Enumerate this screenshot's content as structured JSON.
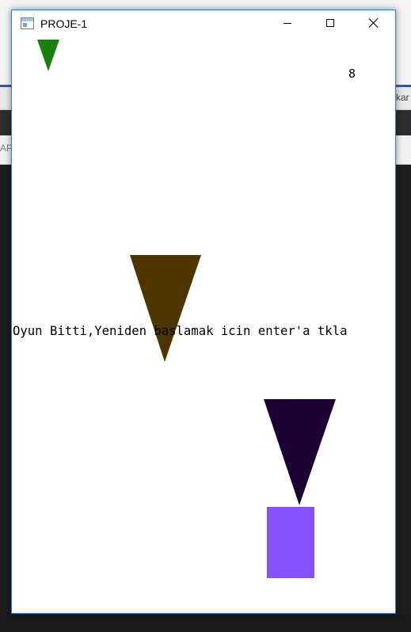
{
  "window": {
    "title": "PROJE-1",
    "icon": "app-window-icon",
    "controls": [
      "minimize-icon",
      "maximize-icon",
      "close-icon"
    ]
  },
  "background_ide": {
    "left_fragment": "AP",
    "right_fragment": "kar"
  },
  "game": {
    "score": "8",
    "message": "Oyun Bitti,Yeniden baslamak icin enter'a tkla",
    "falling_objects": [
      {
        "name": "green-triangle",
        "color": "#1a8010"
      },
      {
        "name": "brown-triangle",
        "color": "#4d3500"
      },
      {
        "name": "dark-purple-triangle",
        "color": "#1e0033"
      }
    ],
    "player": {
      "name": "player-block",
      "color": "#8450fc"
    }
  }
}
